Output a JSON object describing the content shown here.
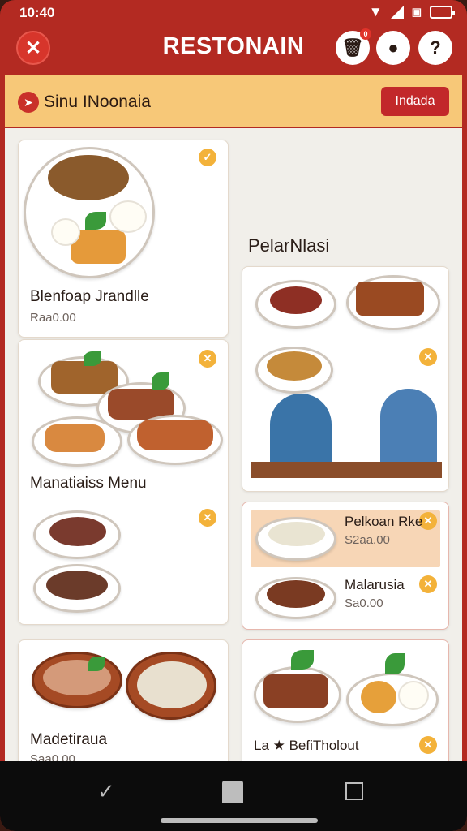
{
  "status": {
    "time": "10:40"
  },
  "header": {
    "title": "RESTONAIN",
    "cart_badge": "0"
  },
  "banner": {
    "text": "Sinu INoonaia",
    "button": "Indada"
  },
  "section_heading": "PelarNlasi",
  "cards": [
    {
      "title": "Blenfoap Jrandlle",
      "price": "Raa0.00"
    },
    {
      "title": "Manatiaiss Menu",
      "price": ""
    },
    {
      "title": "Madetiraua",
      "price": "Saa0.00"
    },
    {
      "title": "Pelkoan Rke",
      "price": "S2aa.00"
    },
    {
      "title": "Malarusia",
      "price": "Sa0.00"
    },
    {
      "title": "La ★ BefiTholout",
      "price": ""
    }
  ],
  "icons": {
    "logo": "restaurant-utensils-icon",
    "cart": "cart-icon",
    "user": "user-icon",
    "help": "help-icon",
    "fav": "check-badge-icon"
  },
  "colors": {
    "brand": "#b32a22",
    "banner": "#f7c878",
    "accent": "#f3b23a"
  }
}
